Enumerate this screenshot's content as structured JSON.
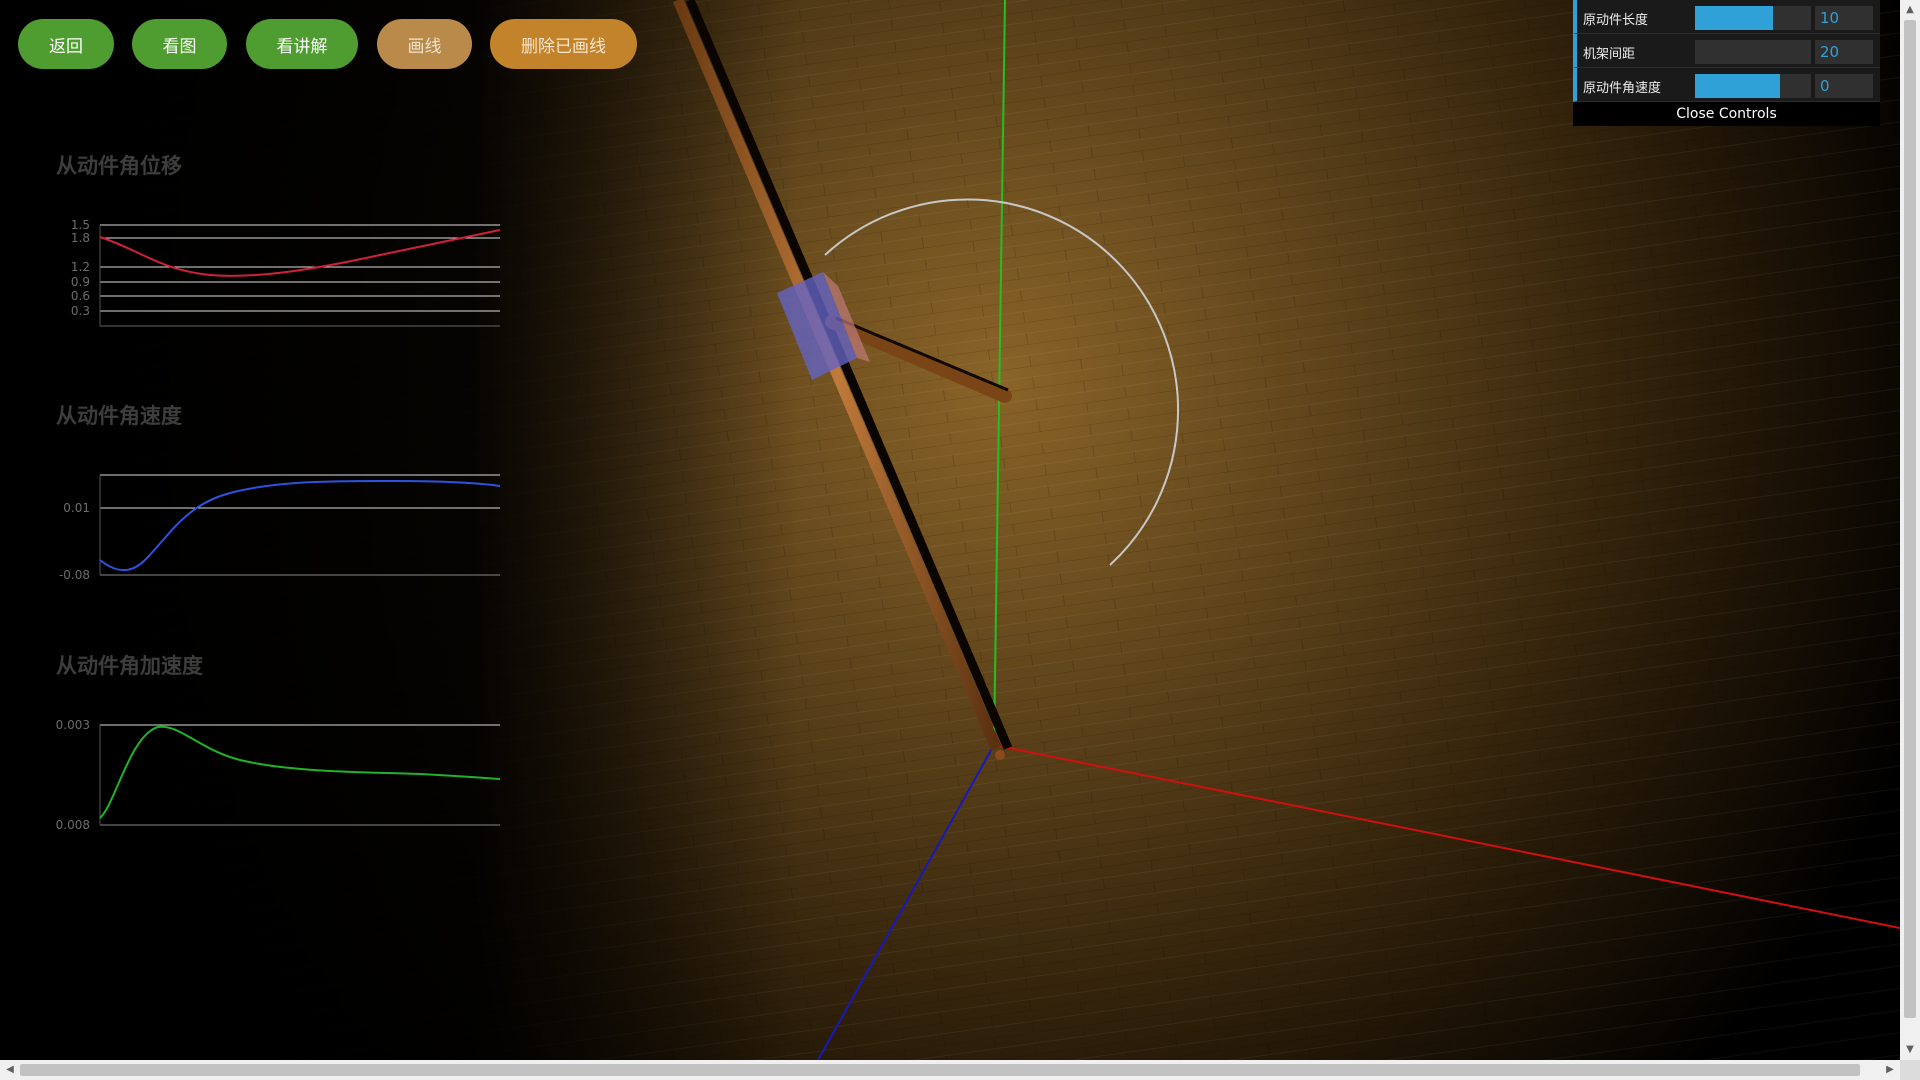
{
  "toolbar": {
    "back_label": "返回",
    "view_chart_label": "看图",
    "explain_label": "看讲解",
    "draw_line_label": "画线",
    "delete_lines_label": "删除已画线"
  },
  "charts": {
    "displacement": {
      "title": "从动件角位移",
      "ticks": [
        "1.5",
        "1.8",
        "1.2",
        "0.9",
        "0.6",
        "0.3"
      ],
      "color": "#d0203a"
    },
    "velocity": {
      "title": "从动件角速度",
      "ticks": [
        "0.01",
        "-0.08"
      ],
      "color": "#2e52e0"
    },
    "acceleration": {
      "title": "从动件角加速度",
      "ticks": [
        "0.003",
        "0.008"
      ],
      "color": "#22b22a"
    }
  },
  "controls": {
    "items": [
      {
        "label": "原动件长度",
        "value": "10",
        "fill": 0.67
      },
      {
        "label": "机架间距",
        "value": "20",
        "fill": 0.0
      },
      {
        "label": "原动件角速度",
        "value": "0",
        "fill": 0.73
      }
    ],
    "close_label": "Close Controls"
  },
  "colors": {
    "axis_x": "#d01010",
    "axis_y": "#22c022",
    "axis_z": "#1818c0",
    "slider_accent": "#2fa1d6",
    "floor": "#6b4a1c"
  }
}
